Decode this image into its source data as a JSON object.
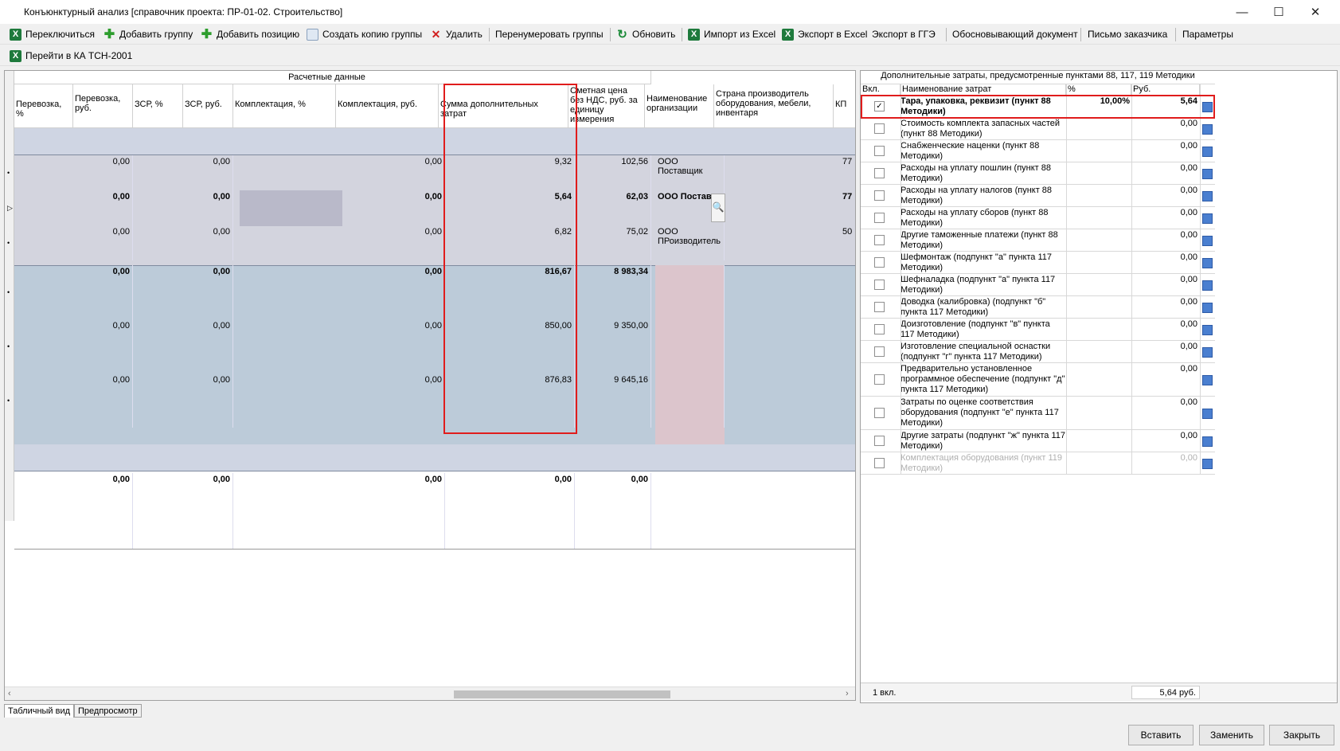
{
  "window": {
    "title": "Конъюнктурный анализ [справочник проекта: ПР-01-02. Строительство]",
    "minimize": "—",
    "maximize": "☐",
    "close": "✕"
  },
  "toolbar1": [
    {
      "label": "Переключиться",
      "icon": "excel-icon"
    },
    {
      "label": "Добавить группу",
      "icon": "plus-icon"
    },
    {
      "label": "Добавить позицию",
      "icon": "plus-icon"
    },
    {
      "label": "Создать копию группы",
      "icon": "copy-icon"
    },
    {
      "label": "Удалить",
      "icon": "delete-icon"
    },
    {
      "label": "Перенумеровать группы",
      "icon": ""
    },
    {
      "label": "Обновить",
      "icon": "refresh-icon"
    },
    {
      "label": "Импорт из Excel",
      "icon": "excel-icon"
    },
    {
      "label": "Экспорт в Excel",
      "icon": "excel-icon"
    },
    {
      "label": "Экспорт в ГГЭ",
      "icon": ""
    },
    {
      "label": "Обосновывающий документ",
      "icon": ""
    },
    {
      "label": "Письмо заказчика",
      "icon": ""
    },
    {
      "label": "Параметры",
      "icon": ""
    }
  ],
  "toolbar2": {
    "label": "Перейти в КА ТСН-2001",
    "icon": "excel-icon"
  },
  "grid": {
    "group_header": "Расчетные данные",
    "columns": [
      "Перевозка, %",
      "Перевозка, руб.",
      "ЗСР, %",
      "ЗСР, руб.",
      "Комплектация, %",
      "Комплектация, руб.",
      "Сумма дополнительных затрат",
      "Сметная цена без НДС, руб. за единицу измерения",
      "Наименование организации",
      "Страна производитель оборудования, мебели, инвентаря",
      "КП"
    ],
    "rows": [
      {
        "c1": "0,00",
        "c3": "0,00",
        "c5": "0,00",
        "c6": "9,32",
        "c7": "102,56",
        "org": "ООО Поставщик",
        "kp": "77",
        "bold": false
      },
      {
        "c1": "0,00",
        "c3": "0,00",
        "c5": "0,00",
        "c6": "5,64",
        "c7": "62,03",
        "org": "ООО Постав...",
        "kp": "77",
        "bold": true
      },
      {
        "c1": "0,00",
        "c3": "0,00",
        "c5": "0,00",
        "c6": "6,82",
        "c7": "75,02",
        "org": "ООО ПРоизводитель",
        "kp": "50",
        "bold": false
      },
      {
        "c1": "0,00",
        "c3": "0,00",
        "c5": "0,00",
        "c6": "816,67",
        "c7": "8 983,34",
        "org": "",
        "kp": "",
        "bold": true
      },
      {
        "c1": "0,00",
        "c3": "0,00",
        "c5": "0,00",
        "c6": "850,00",
        "c7": "9 350,00",
        "org": "",
        "kp": "",
        "bold": false
      },
      {
        "c1": "0,00",
        "c3": "0,00",
        "c5": "0,00",
        "c6": "876,83",
        "c7": "9 645,16",
        "org": "",
        "kp": "",
        "bold": false
      }
    ],
    "totals": {
      "c1": "0,00",
      "c3": "0,00",
      "c5": "0,00",
      "c6": "0,00",
      "c7": "0,00"
    }
  },
  "panel": {
    "title": "Дополнительные затраты, предусмотренные пунктами 88, 117, 119 Методики",
    "col_vkl": "Вкл.",
    "col_name": "Наименование затрат",
    "col_pct": "%",
    "col_rub": "Руб.",
    "items": [
      {
        "name": "Тара, упаковка, реквизит (пункт 88 Методики)",
        "pct": "10,00%",
        "rub": "5,64",
        "checked": true
      },
      {
        "name": "Стоимость комплекта запасных частей (пункт 88 Методики)",
        "pct": "",
        "rub": "0,00",
        "checked": false
      },
      {
        "name": "Снабженческие наценки (пункт 88 Методики)",
        "pct": "",
        "rub": "0,00",
        "checked": false
      },
      {
        "name": "Расходы на уплату пошлин (пункт 88 Методики)",
        "pct": "",
        "rub": "0,00",
        "checked": false
      },
      {
        "name": "Расходы на уплату налогов (пункт 88 Методики)",
        "pct": "",
        "rub": "0,00",
        "checked": false
      },
      {
        "name": "Расходы на уплату сборов (пункт 88 Методики)",
        "pct": "",
        "rub": "0,00",
        "checked": false
      },
      {
        "name": "Другие таможенные платежи (пункт 88 Методики)",
        "pct": "",
        "rub": "0,00",
        "checked": false
      },
      {
        "name": "Шефмонтаж (подпункт \"а\" пункта 117 Методики)",
        "pct": "",
        "rub": "0,00",
        "checked": false
      },
      {
        "name": "Шефналадка (подпункт \"а\" пункта 117 Методики)",
        "pct": "",
        "rub": "0,00",
        "checked": false
      },
      {
        "name": "Доводка (калибровка) (подпункт \"б\" пункта 117 Методики)",
        "pct": "",
        "rub": "0,00",
        "checked": false
      },
      {
        "name": "Доизготовление (подпункт \"в\" пункта 117 Методики)",
        "pct": "",
        "rub": "0,00",
        "checked": false
      },
      {
        "name": "Изготовление специальной оснастки (подпункт \"г\" пункта 117 Методики)",
        "pct": "",
        "rub": "0,00",
        "checked": false
      },
      {
        "name": "Предварительно установленное программное обеспечение (подпункт \"д\" пункта 117 Методики)",
        "pct": "",
        "rub": "0,00",
        "checked": false
      },
      {
        "name": "Затраты по оценке соответствия оборудования (подпункт \"е\" пункта 117 Методики)",
        "pct": "",
        "rub": "0,00",
        "checked": false
      },
      {
        "name": "Другие затраты (подпункт \"ж\" пункта 117 Методики)",
        "pct": "",
        "rub": "0,00",
        "checked": false
      },
      {
        "name": "Комплектация оборудования (пункт 119 Методики)",
        "pct": "",
        "rub": "0,00",
        "checked": false
      }
    ],
    "footer_count": "1 вкл.",
    "footer_sum": "5,64 руб."
  },
  "tabs": [
    "Табличный вид",
    "Предпросмотр"
  ],
  "buttons": {
    "insert": "Вставить",
    "replace": "Заменить",
    "close": "Закрыть"
  }
}
